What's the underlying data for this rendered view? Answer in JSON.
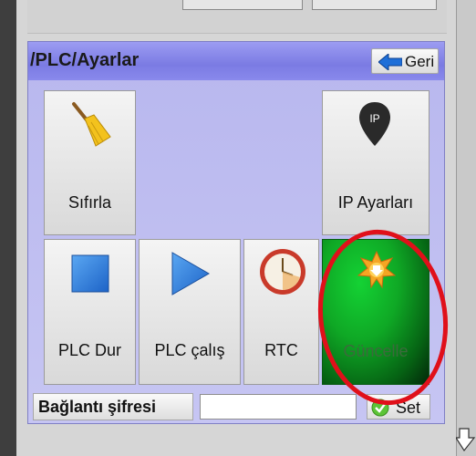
{
  "header": {
    "title": "/PLC/Ayarlar",
    "back_label": "Geri"
  },
  "tiles": {
    "reset": {
      "label": "Sıfırla",
      "icon": "broom-icon"
    },
    "ip_settings": {
      "label": "IP Ayarları",
      "icon": "ip-pin-icon"
    },
    "plc_stop": {
      "label": "PLC Dur",
      "icon": "stop-icon"
    },
    "plc_run": {
      "label": "PLC çalış",
      "icon": "play-icon"
    },
    "rtc": {
      "label": "RTC",
      "icon": "clock-icon"
    },
    "update": {
      "label": "Güncelle",
      "icon": "update-icon"
    }
  },
  "password_row": {
    "label": "Bağlantı şifresi",
    "value": "",
    "set_label": "Set"
  },
  "colors": {
    "header": "#7b7be3",
    "panel": "#b8b7ee",
    "update_tile": "#0fa825",
    "highlight_ring": "#e0101a"
  }
}
